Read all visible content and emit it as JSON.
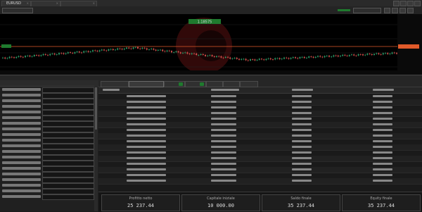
{
  "top_tabs": [
    {
      "title": "EURUSD"
    },
    {
      "title": ""
    },
    {
      "title": ""
    }
  ],
  "controls": {
    "symbol_field": "",
    "speed_field": ""
  },
  "chart": {
    "trade_label": "1.18575"
  },
  "side_panel": {
    "header": "",
    "rows": [
      "",
      "",
      "",
      "",
      "",
      "",
      "",
      "",
      "",
      "",
      "",
      "",
      "",
      "",
      "",
      "",
      "",
      "",
      "",
      ""
    ]
  },
  "results": {
    "tabs": [
      "",
      "",
      "",
      "",
      "",
      "",
      "",
      ""
    ]
  },
  "summary": [
    {
      "label": "Profitto netto",
      "value": "25 237.44"
    },
    {
      "label": "Capitale iniziale",
      "value": "10 000.00"
    },
    {
      "label": "Saldo finale",
      "value": "35 237.44"
    },
    {
      "label": "Equity finale",
      "value": "35 237.44"
    }
  ],
  "colors": {
    "bull": "#2e9e6a",
    "bear": "#d9534f",
    "trade_line": "#e05a2a",
    "accent_green": "#1f7a2e"
  }
}
